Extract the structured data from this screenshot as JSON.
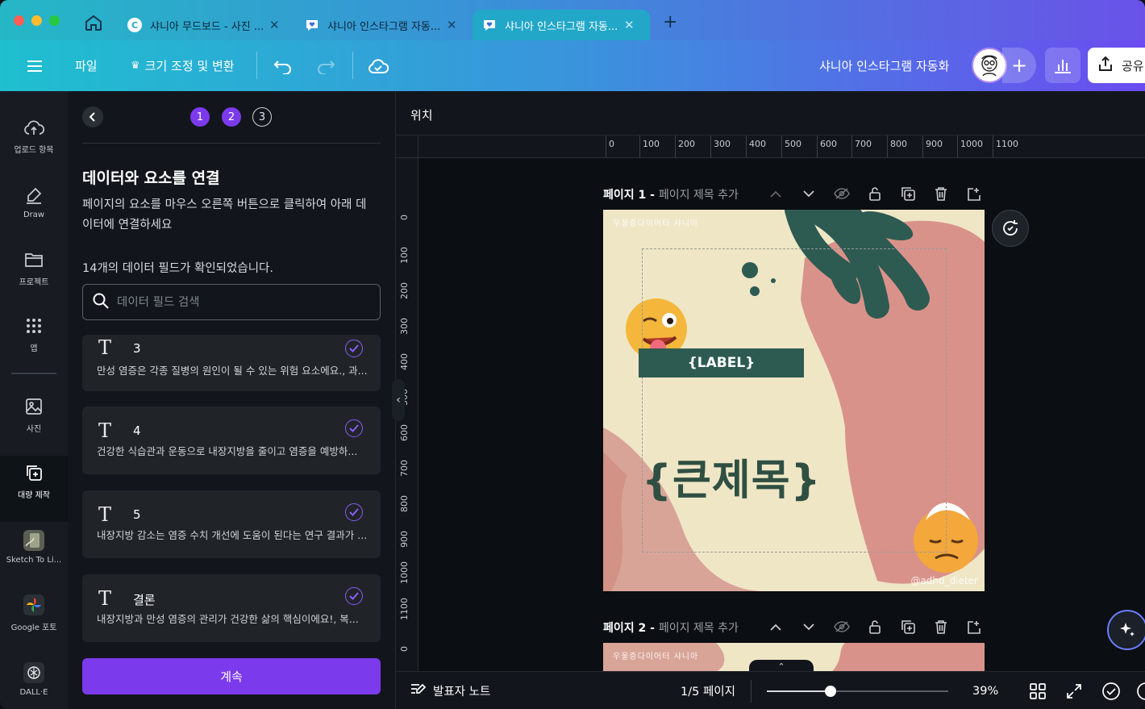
{
  "tabs": [
    {
      "title": "샤니아 무드보드 - 사진 ...",
      "favicon": "canva-c-icon",
      "active": false
    },
    {
      "title": "샤니아 인스타그램 자동...",
      "favicon": "heart-chat-icon",
      "active": false
    },
    {
      "title": "샤니아 인스타그램 자동...",
      "favicon": "heart-chat-icon",
      "active": true
    }
  ],
  "toolbar": {
    "file": "파일",
    "resize": "크기 조정 및 변환",
    "doc_title": "샤니아 인스타그램 자동화",
    "share": "공유"
  },
  "rail": [
    {
      "label": "업로드 항목",
      "icon": "cloud-upload-icon"
    },
    {
      "label": "Draw",
      "icon": "pen-icon"
    },
    {
      "label": "프로젝트",
      "icon": "folder-icon"
    },
    {
      "label": "앱",
      "icon": "grid-icon"
    },
    {
      "label": "사진",
      "icon": "image-icon"
    },
    {
      "label": "대량 제작",
      "icon": "bulk-create-icon"
    },
    {
      "label": "Sketch To Li...",
      "icon": "sketch-app-icon"
    },
    {
      "label": "Google 포토",
      "icon": "google-photos-icon"
    },
    {
      "label": "DALL·E",
      "icon": "dalle-icon"
    }
  ],
  "panel": {
    "steps": [
      "1",
      "2",
      "3"
    ],
    "title": "데이터와 요소를 연결",
    "description": "페이지의 요소를 마우스 오른쪽 버튼으로 클릭하여 아래 데이터에 연결하세요",
    "field_count": "14개의 데이터 필드가 확인되었습니다.",
    "search_placeholder": "데이터 필드 검색",
    "fields": [
      {
        "name": "3",
        "value": "만성 염증은 각종 질병의 원인이 될 수 있는 위험 요소에요., 과..."
      },
      {
        "name": "4",
        "value": "건강한 식습관과 운동으로 내장지방을 줄이고 염증을 예방하..."
      },
      {
        "name": "5",
        "value": "내장지방 감소는 염증 수치 개선에 도움이 된다는 연구 결과가 ..."
      },
      {
        "name": "결론",
        "value": "내장지방과 만성 염증의 관리가 건강한 삶의 핵심이에요!, 복..."
      }
    ],
    "continue": "계속"
  },
  "editor": {
    "position_label": "위치",
    "ruler_h": [
      "0",
      "100",
      "200",
      "300",
      "400",
      "500",
      "600",
      "700",
      "800",
      "900",
      "1000",
      "1100"
    ],
    "ruler_v": [
      "0",
      "100",
      "200",
      "300",
      "400",
      "500",
      "600",
      "700",
      "800",
      "900",
      "1000",
      "1100",
      "0"
    ],
    "pages": [
      {
        "number": "페이지 1 - ",
        "subtitle": "페이지 제목 추가"
      },
      {
        "number": "페이지 2 - ",
        "subtitle": "페이지 제목 추가"
      }
    ],
    "design": {
      "brand": "우울증다이어터 샤니아",
      "label": "{LABEL}",
      "big_title": "{큰제목}",
      "handle": "@adhd_dieter"
    }
  },
  "bottom": {
    "notes": "발표자 노트",
    "page_indicator": "1/5 페이지",
    "zoom": "39%",
    "zoom_fraction": 0.35
  },
  "colors": {
    "accent": "#7c3aed",
    "design_bg": "#efe6c6",
    "design_green": "#2d5b52",
    "design_pink": "#d9928a"
  }
}
